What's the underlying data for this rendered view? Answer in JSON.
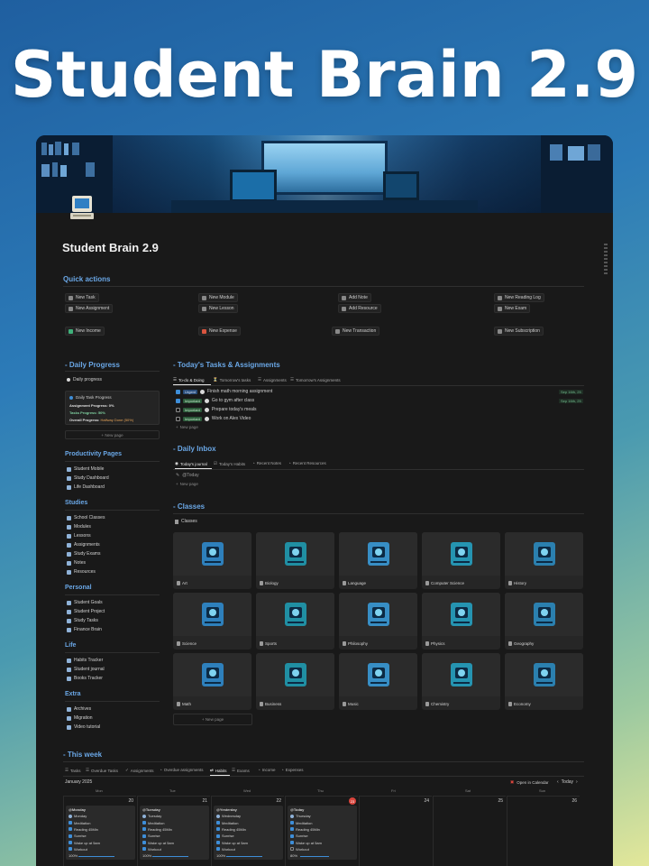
{
  "hero": {
    "title": "Student Brain 2.9"
  },
  "page": {
    "title": "Student Brain 2.9"
  },
  "quick_actions": {
    "heading": "Quick actions",
    "items": [
      "New Task",
      "New Module",
      "Add Note",
      "New Reading Log",
      "New Assignment",
      "New Lesson",
      "Add Resource",
      "New Exam",
      "New Income",
      "New Expense",
      "New Transaction",
      "New Subscription"
    ]
  },
  "daily_progress": {
    "heading": "- Daily Progress",
    "sub": "Daily progress",
    "card_title": "Daily Task Progress",
    "assignment": "Assignment Progress: 0%",
    "tasks": "Tasks Progress: 50%",
    "overall": "Overall Progress:",
    "overall_value": "Halfway Done (50%)",
    "new_page": "New page"
  },
  "sidebar": {
    "productivity": {
      "heading": "Productivity Pages",
      "items": [
        "Student Mobile",
        "Study Dashboard",
        "Life Dashboard"
      ]
    },
    "studies": {
      "heading": "Studies",
      "items": [
        "School Classes",
        "Modules",
        "Lessons",
        "Assignments",
        "Study Exams",
        "Notes",
        "Resources"
      ]
    },
    "personal": {
      "heading": "Personal",
      "items": [
        "Student Goals",
        "Student Project",
        "Study Tasks",
        "Finance Brain"
      ]
    },
    "life": {
      "heading": "Life",
      "items": [
        "Habits Tracker",
        "Student journal",
        "Books Tracker"
      ]
    },
    "extra": {
      "heading": "Extra",
      "items": [
        "Archives",
        "Migration",
        "Video tutorial"
      ]
    }
  },
  "todays_tasks": {
    "heading": "- Today's Tasks & Assignments",
    "tabs": [
      "To-do & Doing",
      "Tomorrow's tasks",
      "Assignments",
      "Tomorrow's Assignments"
    ],
    "rows": [
      {
        "tag": "Urgent",
        "text": "Finish math morning assignment",
        "checked": true,
        "date": "Sep 16th, 25"
      },
      {
        "tag": "Important",
        "text": "Go to gym after class",
        "checked": true,
        "date": "Sep 16th, 25"
      },
      {
        "tag": "Important",
        "text": "Prepare today's meals",
        "checked": false,
        "date": ""
      },
      {
        "tag": "Important",
        "text": "Work on Alex Video",
        "checked": false,
        "date": ""
      }
    ],
    "new_page": "New page"
  },
  "daily_inbox": {
    "heading": "- Daily Inbox",
    "tabs": [
      "Today's journal",
      "Today's Habits",
      "Recent Notes",
      "Recent Resources"
    ],
    "entry": "@Today",
    "new_page": "New page"
  },
  "classes": {
    "heading": "- Classes",
    "sub": "Classes",
    "items": [
      "Art",
      "Biology",
      "Language",
      "Computer Science",
      "History",
      "Science",
      "Sports",
      "Philosophy",
      "Physics",
      "Geography",
      "Math",
      "Business",
      "Music",
      "Chemistry",
      "Economy"
    ],
    "new_page": "New page"
  },
  "this_week": {
    "heading": "- This week",
    "tabs": [
      "Tasks",
      "Overdue Tasks",
      "Assignments",
      "Overdue assignments",
      "Habits",
      "Exams",
      "Income",
      "Expenses"
    ],
    "month": "January 2025",
    "open_calendar": "Open in Calendar",
    "today_btn": "Today",
    "weekdays": [
      "Mon",
      "Tue",
      "Wed",
      "Thu",
      "Fri",
      "Sat",
      "Sun"
    ],
    "days": [
      {
        "num": "20",
        "title": "@Monday",
        "day": "Monday",
        "progress": "100%",
        "last_checked": true
      },
      {
        "num": "21",
        "title": "@Tuesday",
        "day": "Tuesday",
        "progress": "100%",
        "last_checked": true
      },
      {
        "num": "22",
        "title": "@Yesterday",
        "day": "Wednesday",
        "progress": "100%",
        "last_checked": true
      },
      {
        "num": "23",
        "title": "@Today",
        "day": "Thursday",
        "progress": "80%",
        "last_checked": false
      },
      {
        "num": "24"
      },
      {
        "num": "25"
      },
      {
        "num": "26"
      }
    ],
    "habits": [
      "Meditation",
      "Reading 45Min",
      "Sunrise",
      "Wake up at 5am",
      "Workout"
    ]
  }
}
